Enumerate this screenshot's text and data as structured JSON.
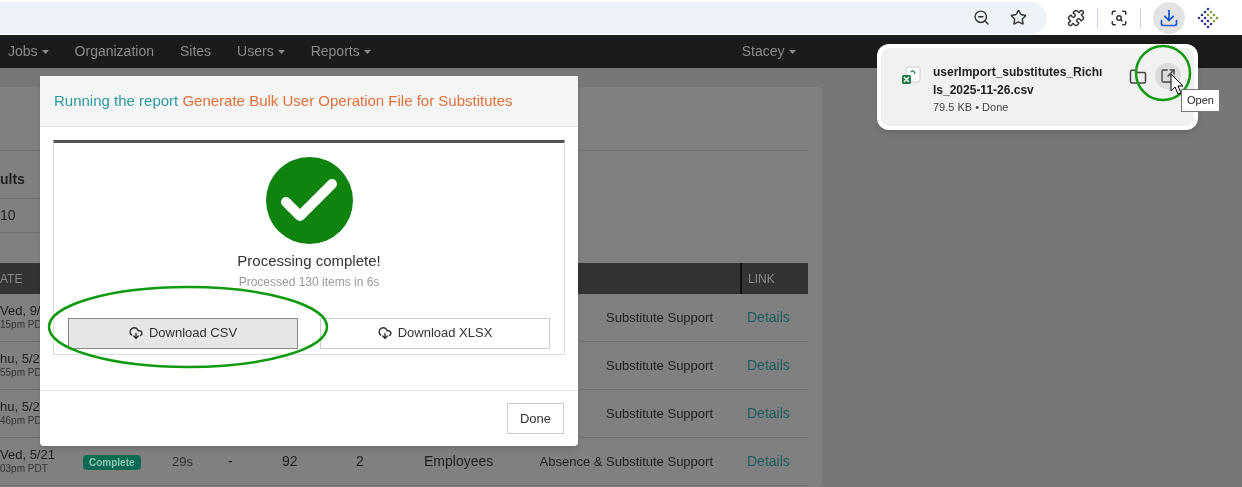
{
  "nav": {
    "items": [
      {
        "label": "Jobs",
        "dropdown": true
      },
      {
        "label": "Organization",
        "dropdown": false
      },
      {
        "label": "Sites",
        "dropdown": false
      },
      {
        "label": "Users",
        "dropdown": true
      },
      {
        "label": "Reports",
        "dropdown": true
      }
    ],
    "user": {
      "label": "Stacey",
      "dropdown": true
    }
  },
  "page": {
    "filter_label": "ults",
    "filter_value": "10",
    "table": {
      "columns": [
        "ATE",
        "LINK"
      ],
      "rows": [
        {
          "date": "Ved, 9/",
          "time": "15pm PD",
          "type": "Substitute Support",
          "link": "Details"
        },
        {
          "date": "hu, 5/2",
          "time": "55pm PD",
          "type": "Substitute Support",
          "link": "Details"
        },
        {
          "date": "hu, 5/2",
          "time": "46pm PD",
          "type": "Substitute Support",
          "link": "Details"
        },
        {
          "date": "Ved, 5/21",
          "time": "03pm PDT",
          "status": "Complete",
          "duration": "29s",
          "column_5": "-",
          "column_6": "92",
          "column_7": "2",
          "category": "Employees",
          "type": "Absence & Substitute Support",
          "link": "Details"
        }
      ]
    }
  },
  "modal": {
    "title_prefix": "Running the report",
    "title_name": "Generate Bulk User Operation File for Substitutes",
    "status": "Processing complete!",
    "detail": "Processed 130 items in 6s",
    "buttons": [
      {
        "label": "Download CSV",
        "selected": true
      },
      {
        "label": "Download XLSX",
        "selected": false
      }
    ],
    "done": "Done"
  },
  "downloads": {
    "name_lines": [
      "userImport_substitutes_Richı",
      "ls_2025-11-26.csv"
    ],
    "info": "79.5 KB • Done",
    "tooltip": "Open"
  }
}
